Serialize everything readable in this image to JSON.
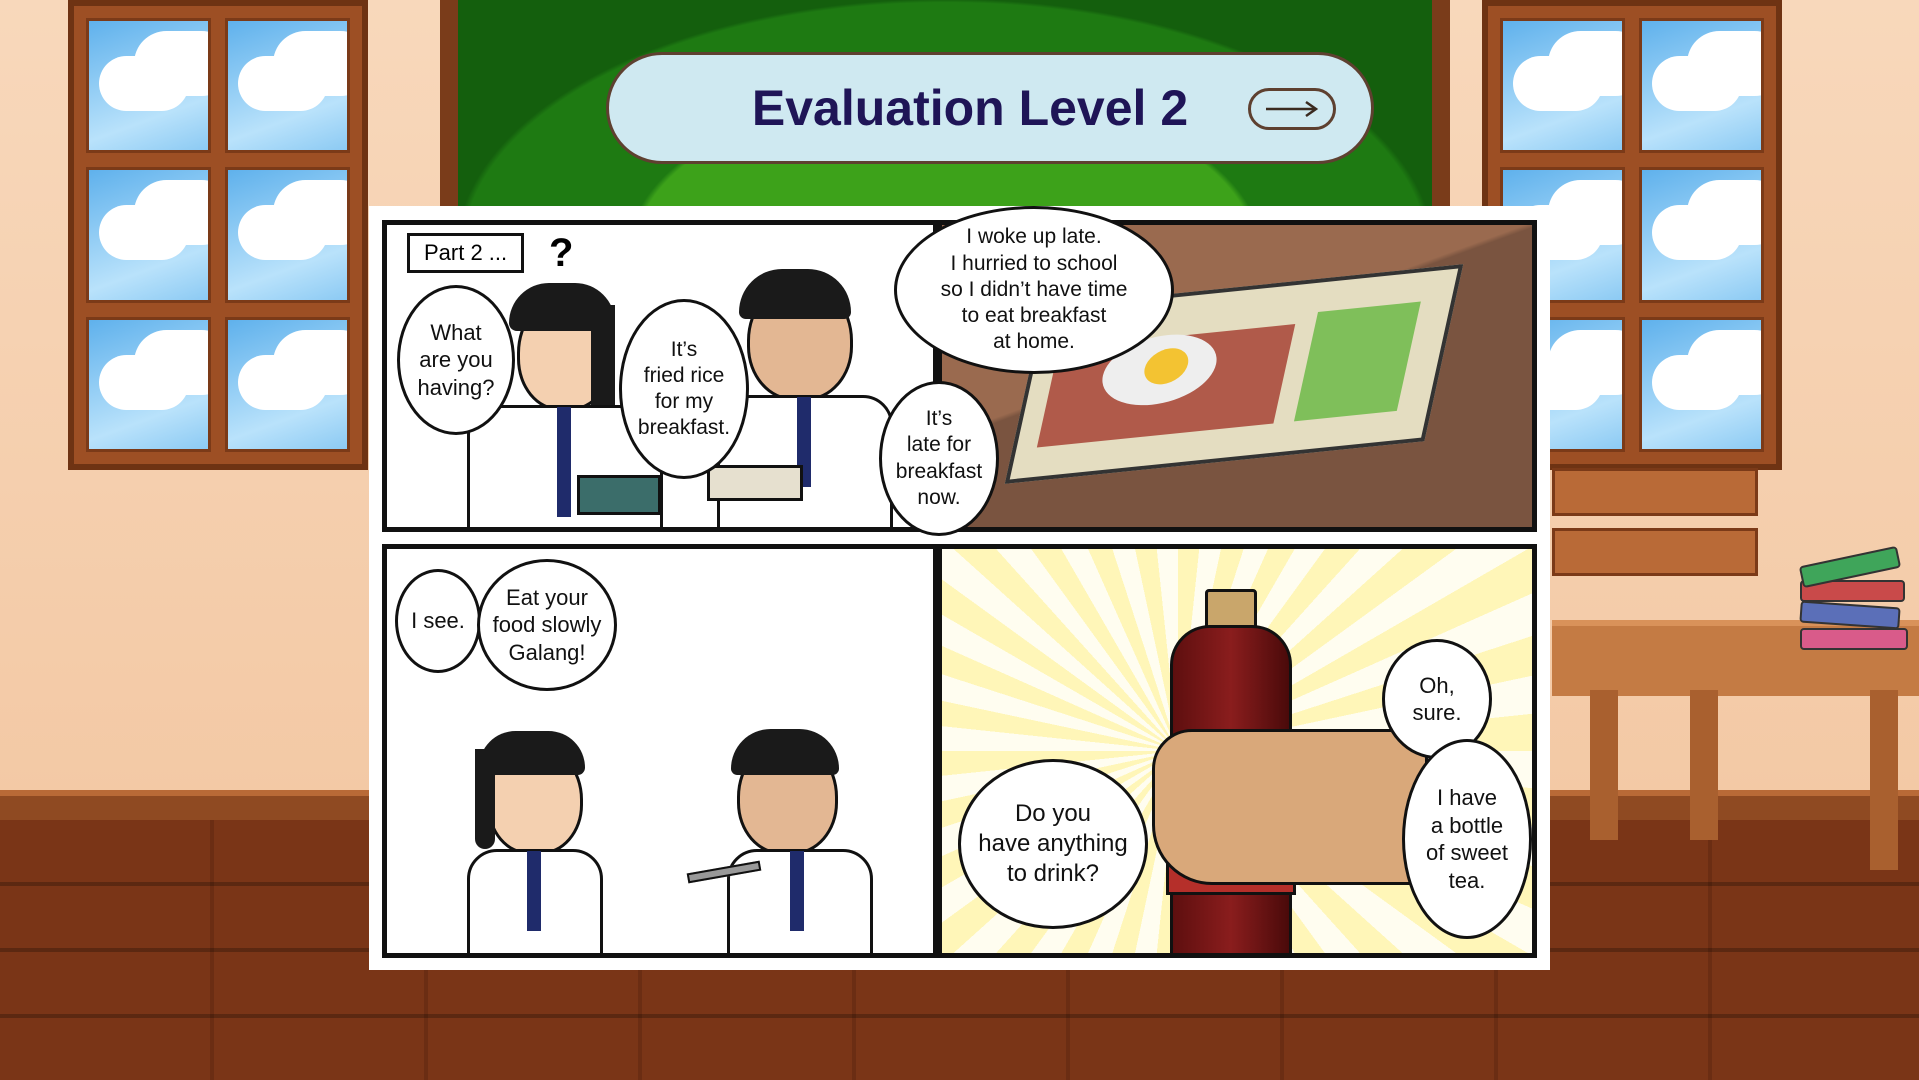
{
  "header": {
    "title": "Evaluation Level 2",
    "next_icon": "arrow-right-icon"
  },
  "comic": {
    "part_label": "Part 2 ...",
    "question_mark": "?",
    "panel1": {
      "bubble_girl": "What\nare you\nhaving?",
      "bubble_boy_reply": "It’s\nfried rice\nfor my\nbreakfast.",
      "bubble_boy_story": "I woke up late.\nI hurried to school\nso I didn’t have time\nto eat breakfast\nat home.",
      "bubble_boy_late": "It’s\nlate for\nbreakfast\nnow."
    },
    "panel3": {
      "bubble_see": "I see.",
      "bubble_eat": "Eat your\nfood slowly\nGalang!"
    },
    "panel4": {
      "bubble_drink": "Do you\nhave anything\nto drink?",
      "bubble_sure": "Oh,\nsure.",
      "bubble_tea": "I have\na bottle\nof sweet\ntea."
    }
  },
  "colors": {
    "title_text": "#1f1557",
    "pill_bg": "#cfe9f1",
    "board_green": "#1e7a12",
    "wall": "#f6d3b4",
    "floor": "#7a3517"
  }
}
